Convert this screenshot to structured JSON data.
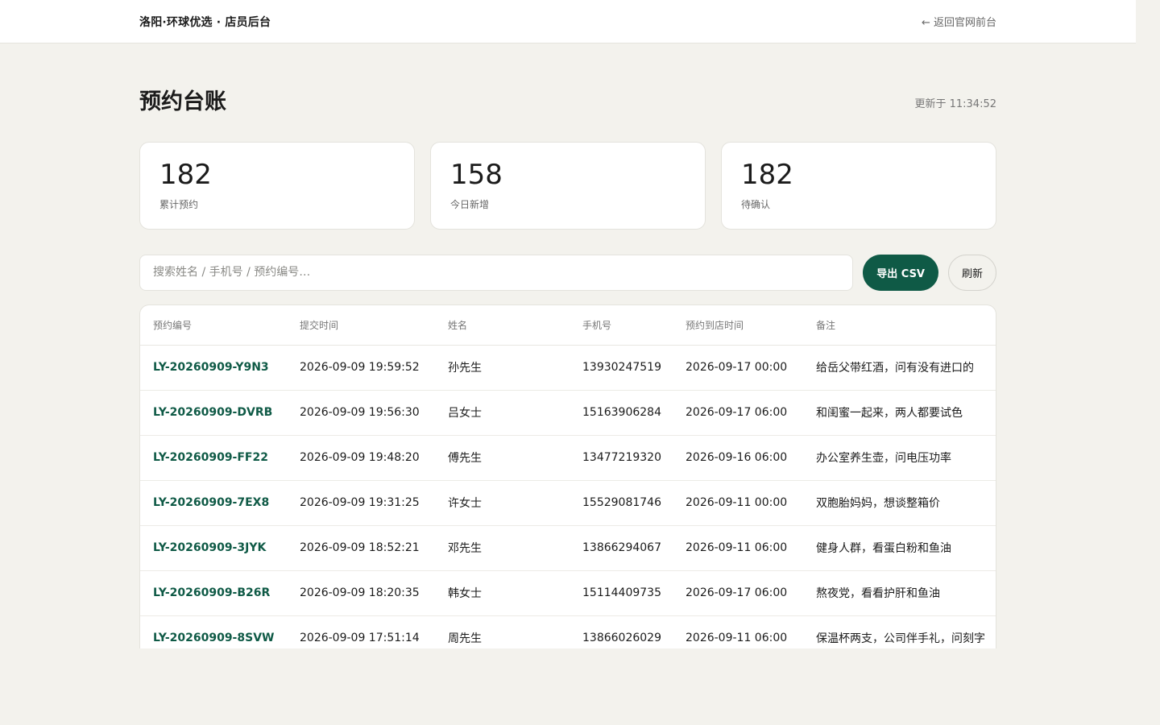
{
  "header": {
    "brand": "洛阳·环球优选 · 店员后台",
    "back_link": "← 返回官网前台"
  },
  "page": {
    "title": "预约台账",
    "updated": "更新于 11:34:52"
  },
  "stats": [
    {
      "value": "182",
      "label": "累计预约"
    },
    {
      "value": "158",
      "label": "今日新增"
    },
    {
      "value": "182",
      "label": "待确认"
    }
  ],
  "toolbar": {
    "search_placeholder": "搜索姓名 / 手机号 / 预约编号…",
    "search_value": "",
    "export_label": "导出 CSV",
    "refresh_label": "刷新"
  },
  "table": {
    "headers": [
      "预约编号",
      "提交时间",
      "姓名",
      "手机号",
      "预约到店时间",
      "备注"
    ],
    "rows": [
      [
        "LY-20260909-Y9N3",
        "2026-09-09 19:59:52",
        "孙先生",
        "13930247519",
        "2026-09-17 00:00",
        "给岳父带红酒，问有没有进口的"
      ],
      [
        "LY-20260909-DVRB",
        "2026-09-09 19:56:30",
        "吕女士",
        "15163906284",
        "2026-09-17 06:00",
        "和闺蜜一起来，两人都要试色"
      ],
      [
        "LY-20260909-FF22",
        "2026-09-09 19:48:20",
        "傅先生",
        "13477219320",
        "2026-09-16 06:00",
        "办公室养生壶，问电压功率"
      ],
      [
        "LY-20260909-7EX8",
        "2026-09-09 19:31:25",
        "许女士",
        "15529081746",
        "2026-09-11 00:00",
        "双胞胎妈妈，想谈整箱价"
      ],
      [
        "LY-20260909-3JYK",
        "2026-09-09 18:52:21",
        "邓先生",
        "13866294067",
        "2026-09-11 06:00",
        "健身人群，看蛋白粉和鱼油"
      ],
      [
        "LY-20260909-B26R",
        "2026-09-09 18:20:35",
        "韩女士",
        "15114409735",
        "2026-09-17 06:00",
        "熬夜党，看看护肝和鱼油"
      ],
      [
        "LY-20260909-8SVW",
        "2026-09-09 17:51:14",
        "周先生",
        "13866026029",
        "2026-09-11 06:00",
        "保温杯两支，公司伴手礼，问刻字"
      ]
    ]
  },
  "colors": {
    "accent": "#0f5a46",
    "background": "#f3f2ed"
  }
}
